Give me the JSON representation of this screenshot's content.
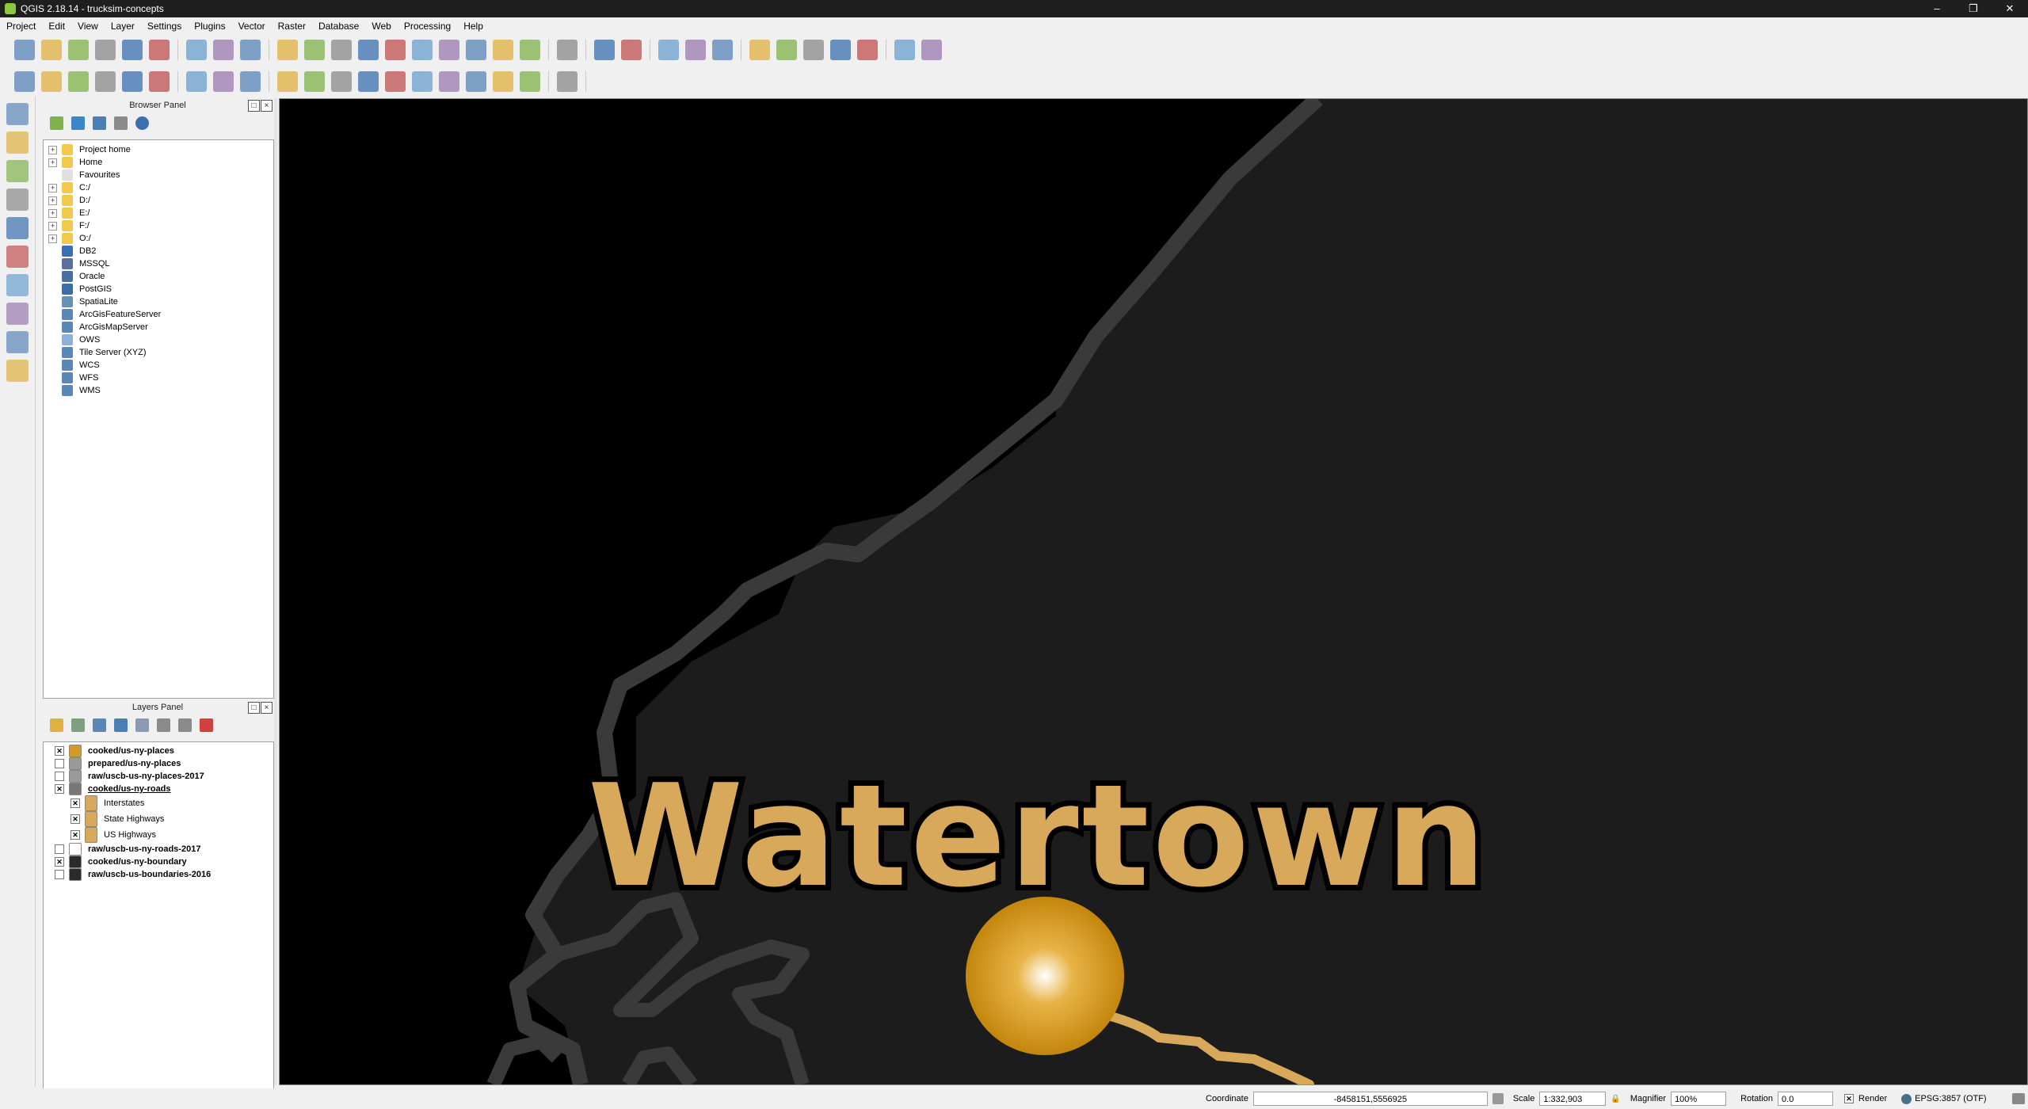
{
  "window": {
    "title": "QGIS 2.18.14 - trucksim-concepts"
  },
  "menu": [
    "Project",
    "Edit",
    "View",
    "Layer",
    "Settings",
    "Plugins",
    "Vector",
    "Raster",
    "Database",
    "Web",
    "Processing",
    "Help"
  ],
  "toolbar_icons": {
    "row1": [
      "new-project-icon",
      "open-project-icon",
      "save-project-icon",
      "save-as-icon",
      "print-composer-icon",
      "composer-manager-icon",
      "pan-to-selection-icon",
      "pan-icon",
      "pan-map-icon",
      "zoom-in-icon",
      "zoom-out-icon",
      "zoom-native-icon",
      "zoom-full-icon",
      "zoom-selection-icon",
      "zoom-layer-icon",
      "zoom-last-icon",
      "zoom-next-icon",
      "new-bookmark-icon",
      "show-bookmarks-icon",
      "refresh-icon",
      "identify-icon",
      "action-icon",
      "select-feature-icon",
      "select-value-icon",
      "deselect-icon",
      "attribute-table-icon",
      "field-calculator-icon",
      "statistics-icon",
      "measure-icon",
      "map-tips-icon",
      "text-annotation-icon",
      "help-icon"
    ],
    "row2": [
      "current-edits-icon",
      "toggle-editing-icon",
      "save-edits-icon",
      "add-feature-icon",
      "move-feature-icon",
      "node-tool-icon",
      "delete-selected-icon",
      "cut-features-icon",
      "copy-features-icon",
      "paste-features-icon",
      "label-icon",
      "diagram-icon",
      "pin-labels-icon",
      "show-labels-icon",
      "move-label-icon",
      "rotate-label-icon",
      "change-label-icon",
      "label-tool-icon",
      "csw-icon",
      "python-icon"
    ]
  },
  "browser": {
    "title": "Browser Panel",
    "items": [
      {
        "label": "Project home",
        "icon": "folder-icon",
        "color": "#f2c94c",
        "expand": true
      },
      {
        "label": "Home",
        "icon": "folder-icon",
        "color": "#f2c94c",
        "expand": true
      },
      {
        "label": "Favourites",
        "icon": "star-icon",
        "color": "#e0e0e0",
        "expand": false
      },
      {
        "label": "C:/",
        "icon": "folder-icon",
        "color": "#f2c94c",
        "expand": true
      },
      {
        "label": "D:/",
        "icon": "folder-icon",
        "color": "#f2c94c",
        "expand": true
      },
      {
        "label": "E:/",
        "icon": "folder-icon",
        "color": "#f2c94c",
        "expand": true
      },
      {
        "label": "F:/",
        "icon": "folder-icon",
        "color": "#f2c94c",
        "expand": true
      },
      {
        "label": "O:/",
        "icon": "folder-icon",
        "color": "#f2c94c",
        "expand": true
      },
      {
        "label": "DB2",
        "icon": "db2-icon",
        "color": "#3a6fb0",
        "expand": false
      },
      {
        "label": "MSSQL",
        "icon": "mssql-icon",
        "color": "#5a6fa0",
        "expand": false
      },
      {
        "label": "Oracle",
        "icon": "oracle-icon",
        "color": "#4b6fa5",
        "expand": false
      },
      {
        "label": "PostGIS",
        "icon": "postgis-icon",
        "color": "#3b6ea5",
        "expand": false
      },
      {
        "label": "SpatiaLite",
        "icon": "spatialite-icon",
        "color": "#6a8fb5",
        "expand": false
      },
      {
        "label": "ArcGisFeatureServer",
        "icon": "arcgis-feature-icon",
        "color": "#5a86b8",
        "expand": false
      },
      {
        "label": "ArcGisMapServer",
        "icon": "arcgis-map-icon",
        "color": "#5a86b8",
        "expand": false
      },
      {
        "label": "OWS",
        "icon": "ows-icon",
        "color": "#8fb0d8",
        "expand": false
      },
      {
        "label": "Tile Server (XYZ)",
        "icon": "xyz-icon",
        "color": "#5a86b8",
        "expand": false
      },
      {
        "label": "WCS",
        "icon": "wcs-icon",
        "color": "#5a86b8",
        "expand": false
      },
      {
        "label": "WFS",
        "icon": "wfs-icon",
        "color": "#5a86b8",
        "expand": false
      },
      {
        "label": "WMS",
        "icon": "wms-icon",
        "color": "#5a86b8",
        "expand": false
      }
    ]
  },
  "layers": {
    "title": "Layers Panel",
    "items": [
      {
        "label": "cooked/us-ny-places",
        "checked": true,
        "icon": "point-layer-icon",
        "color": "#d49a25",
        "indent": 0,
        "underline": false
      },
      {
        "label": "prepared/us-ny-places",
        "checked": false,
        "icon": "point-layer-icon",
        "color": "#999999",
        "indent": 0,
        "underline": false
      },
      {
        "label": "raw/uscb-us-ny-places-2017",
        "checked": false,
        "icon": "polygon-layer-icon",
        "color": "#9a9a9a",
        "indent": 0,
        "underline": false
      },
      {
        "label": "cooked/us-ny-roads",
        "checked": true,
        "icon": "line-layer-icon",
        "color": "#777777",
        "indent": 0,
        "underline": true
      }
    ],
    "road_classes": [
      {
        "label": "Interstates",
        "checked": true,
        "color": "#d8a95a"
      },
      {
        "label": "State Highways",
        "checked": true,
        "color": "#d8a95a"
      },
      {
        "label": "US Highways",
        "checked": true,
        "color": "#d8a95a"
      }
    ],
    "more": [
      {
        "label": "raw/uscb-us-ny-roads-2017",
        "checked": false,
        "icon": "line-layer-icon",
        "color": "#ffffff"
      },
      {
        "label": "cooked/us-ny-boundary",
        "checked": true,
        "icon": "polygon-layer-icon",
        "color": "#2a2a2a"
      },
      {
        "label": "raw/uscb-us-boundaries-2016",
        "checked": false,
        "icon": "polygon-layer-icon",
        "color": "#2a2a2a"
      }
    ]
  },
  "map": {
    "place_label": "Watertown",
    "label_color": "#d8a95a",
    "background": "#1c1c1c",
    "water_color": "#000000",
    "boundary_color": "#3a3a3a",
    "marker_color": "#d4920f"
  },
  "status": {
    "coordinate_label": "Coordinate",
    "coordinate_value": "-8458151,5556925",
    "scale_label": "Scale",
    "scale_value": "1:332,903",
    "magnifier_label": "Magnifier",
    "magnifier_value": "100%",
    "rotation_label": "Rotation",
    "rotation_value": "0.0",
    "render_label": "Render",
    "crs_label": "EPSG:3857 (OTF)"
  }
}
